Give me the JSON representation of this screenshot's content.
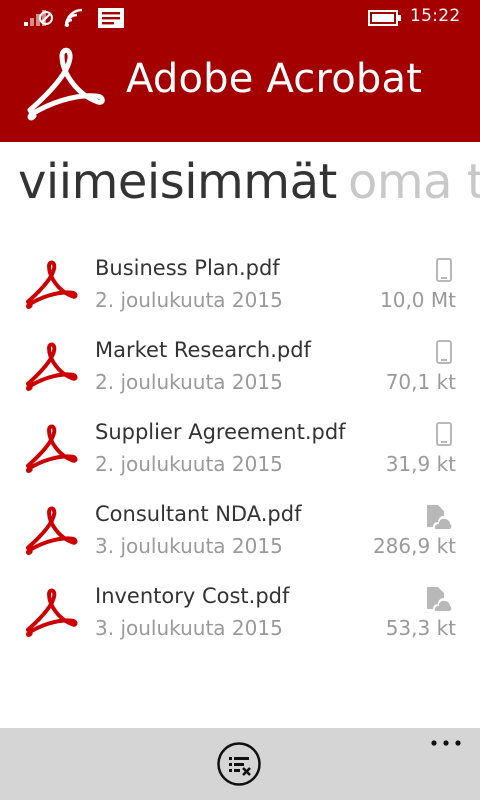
{
  "status_bar": {
    "time": "15:22",
    "icons": [
      "signal-icon",
      "wifi-icon",
      "message-icon",
      "battery-icon"
    ]
  },
  "header": {
    "title": "Adobe Acrobat",
    "logo": "adobe-acrobat-logo",
    "background_color": "#a50000"
  },
  "pivot": {
    "items": [
      {
        "label": "viimeisimmät",
        "active": true
      },
      {
        "label": "oma t",
        "active": false
      }
    ]
  },
  "files": [
    {
      "name": "Business Plan.pdf",
      "date": "2. joulukuuta 2015",
      "size": "10,0 Mt",
      "location_icon": "phone-icon"
    },
    {
      "name": "Market Research.pdf",
      "date": "2. joulukuuta 2015",
      "size": "70,1 kt",
      "location_icon": "phone-icon"
    },
    {
      "name": "Supplier Agreement.pdf",
      "date": "2. joulukuuta 2015",
      "size": "31,9 kt",
      "location_icon": "phone-icon"
    },
    {
      "name": "Consultant NDA.pdf",
      "date": "3. joulukuuta 2015",
      "size": "286,9 kt",
      "location_icon": "cloud-document-icon"
    },
    {
      "name": "Inventory Cost.pdf",
      "date": "3. joulukuuta 2015",
      "size": "53,3 kt",
      "location_icon": "cloud-document-icon"
    }
  ],
  "app_bar": {
    "buttons": [
      "clear-list-icon",
      "more-options-icon"
    ]
  },
  "colors": {
    "accent": "#a50000",
    "pdf_icon": "#cc0000",
    "text_primary": "#333333",
    "text_secondary": "#9a9a9a",
    "app_bar": "#d5d5d5"
  }
}
